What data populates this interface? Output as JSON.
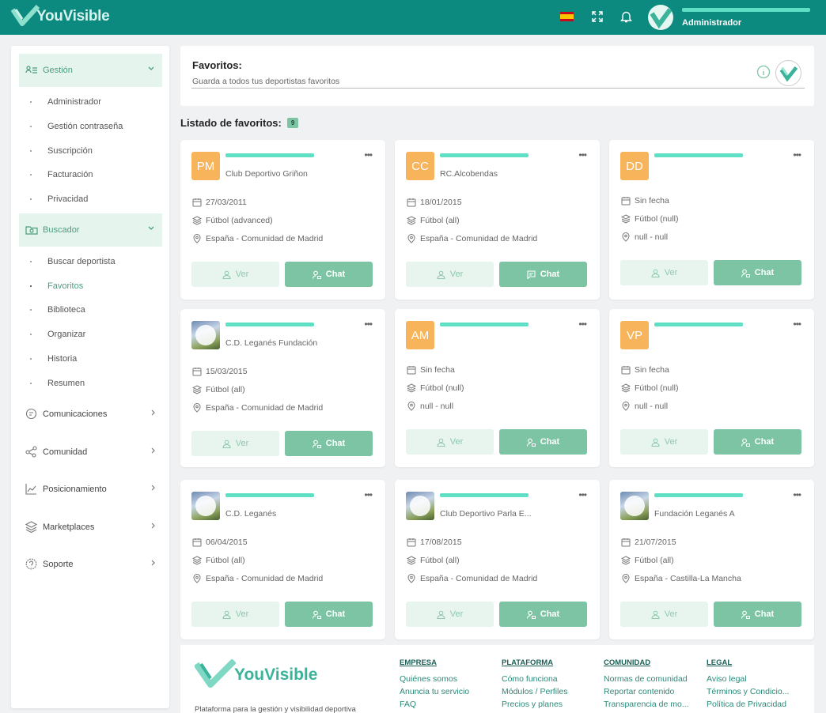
{
  "app": {
    "name": "YouVisible"
  },
  "topbar": {
    "user_role": "Administrador",
    "language_flag": "es",
    "icons": [
      "flag-es-icon",
      "fullscreen-icon",
      "bell-icon"
    ]
  },
  "sidebar": {
    "groups": [
      {
        "label": "Gestión",
        "items": [
          "Administrador",
          "Gestión contraseña",
          "Suscripción",
          "Facturación",
          "Privacidad"
        ]
      },
      {
        "label": "Buscador",
        "items": [
          "Buscar deportista",
          "Favoritos",
          "Biblioteca",
          "Organizar",
          "Historia",
          "Resumen"
        ],
        "active_item": "Favoritos"
      }
    ],
    "main_items": [
      "Comunicaciones",
      "Comunidad",
      "Posicionamiento",
      "Marketplaces",
      "Soporte"
    ]
  },
  "header": {
    "title": "Favoritos:",
    "subtitle": "Guarda a todos tus deportistas favoritos"
  },
  "list": {
    "title": "Listado de favoritos:",
    "count": "9"
  },
  "buttons": {
    "ver": "Ver",
    "chat": "Chat"
  },
  "cards": [
    {
      "initials": "PM",
      "club": "Club Deportivo Griñon",
      "date": "27/03/2011",
      "sport": "Fútbol (advanced)",
      "location": "España - Comunidad de Madrid"
    },
    {
      "initials": "CC",
      "club": "RC.Alcobendas",
      "date": "18/01/2015",
      "sport": "Fútbol (all)",
      "location": "España - Comunidad de Madrid"
    },
    {
      "initials": "DD",
      "club": "",
      "date": "Sin fecha",
      "sport": "Fútbol (null)",
      "location": "null - null"
    },
    {
      "initials": "",
      "club": "C.D. Leganés Fundación",
      "date": "15/03/2015",
      "sport": "Fútbol (all)",
      "location": "España - Comunidad de Madrid"
    },
    {
      "initials": "AM",
      "club": "",
      "date": "Sin fecha",
      "sport": "Fútbol (null)",
      "location": "null - null"
    },
    {
      "initials": "VP",
      "club": "",
      "date": "Sin fecha",
      "sport": "Fútbol (null)",
      "location": "null - null"
    },
    {
      "initials": "",
      "club": "C.D. Leganés",
      "date": "06/04/2015",
      "sport": "Fútbol (all)",
      "location": "España - Comunidad de Madrid"
    },
    {
      "initials": "",
      "club": "Club Deportivo Parla E...",
      "date": "17/08/2015",
      "sport": "Fútbol (all)",
      "location": "España - Comunidad de Madrid"
    },
    {
      "initials": "",
      "club": "Fundación Leganés A",
      "date": "21/07/2015",
      "sport": "Fútbol (all)",
      "location": "España - Castilla-La Mancha"
    }
  ],
  "footer": {
    "tagline": "Plataforma para la gestión y visibilidad deportiva",
    "columns": [
      {
        "heading": "EMPRESA",
        "links": [
          "Quiénes somos",
          "Anuncia tu servicio",
          "FAQ"
        ]
      },
      {
        "heading": "PLATAFORMA",
        "links": [
          "Cómo funciona",
          "Módulos / Perfiles",
          "Precios y planes"
        ]
      },
      {
        "heading": "COMUNIDAD",
        "links": [
          "Normas de comunidad",
          "Reportar contenido",
          "Transparencia de mo..."
        ]
      },
      {
        "heading": "LEGAL",
        "links": [
          "Aviso legal",
          "Términos y Condicio...",
          "Política de Privacidad"
        ]
      }
    ]
  },
  "colors": {
    "brand": "#0d8a80",
    "accent": "#7cc4a3",
    "avatar": "#f7b45a"
  }
}
